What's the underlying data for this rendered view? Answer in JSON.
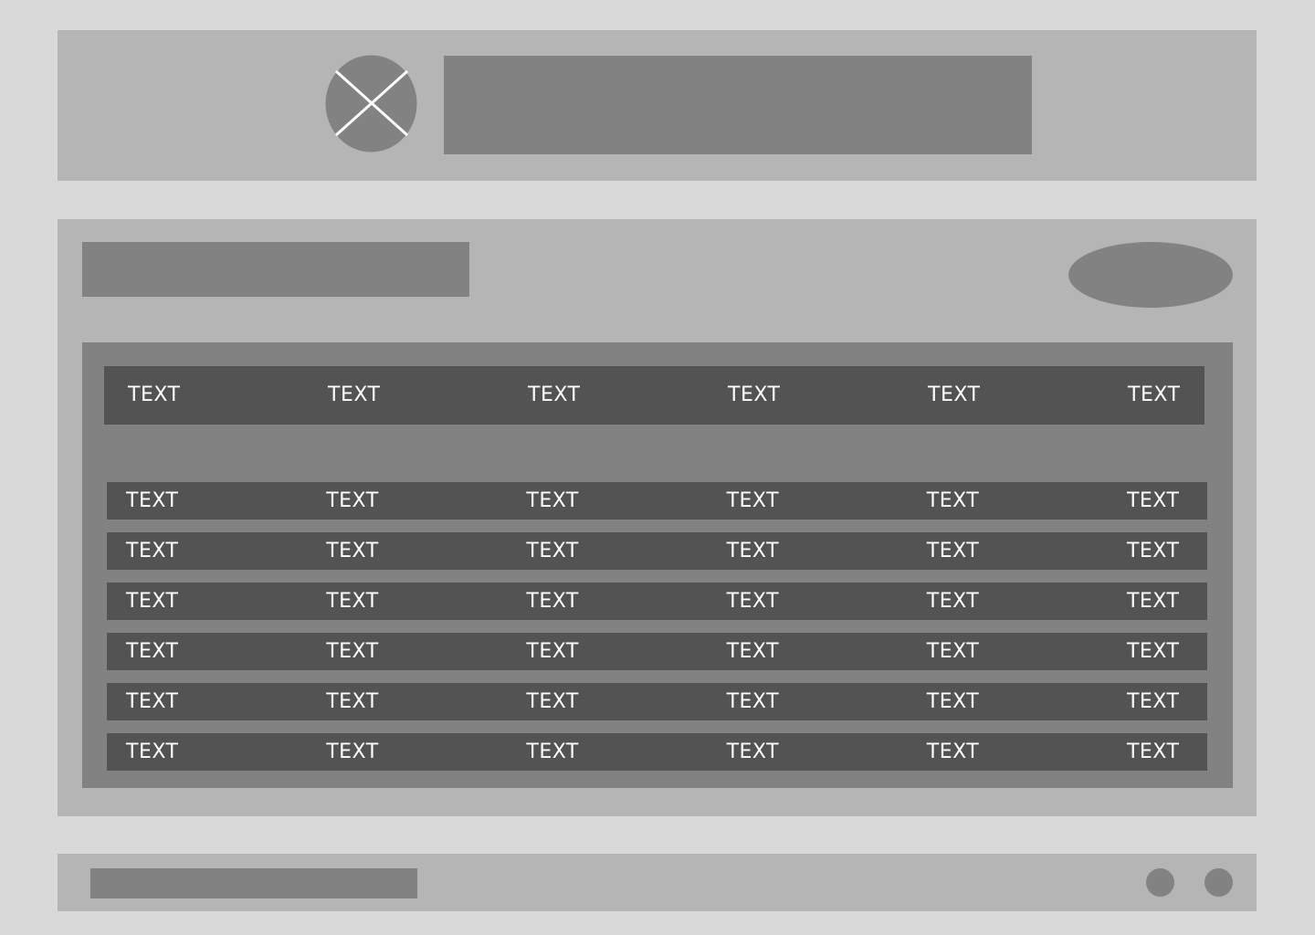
{
  "header": {
    "logo_icon": "image-placeholder-icon"
  },
  "table": {
    "headers": [
      "TEXT",
      "TEXT",
      "TEXT",
      "TEXT",
      "TEXT",
      "TEXT"
    ],
    "rows": [
      [
        "TEXT",
        "TEXT",
        "TEXT",
        "TEXT",
        "TEXT",
        "TEXT"
      ],
      [
        "TEXT",
        "TEXT",
        "TEXT",
        "TEXT",
        "TEXT",
        "TEXT"
      ],
      [
        "TEXT",
        "TEXT",
        "TEXT",
        "TEXT",
        "TEXT",
        "TEXT"
      ],
      [
        "TEXT",
        "TEXT",
        "TEXT",
        "TEXT",
        "TEXT",
        "TEXT"
      ],
      [
        "TEXT",
        "TEXT",
        "TEXT",
        "TEXT",
        "TEXT",
        "TEXT"
      ],
      [
        "TEXT",
        "TEXT",
        "TEXT",
        "TEXT",
        "TEXT",
        "TEXT"
      ]
    ]
  },
  "colors": {
    "page_background": "#d9d9d9",
    "panel": "#b6b5b5",
    "placeholder": "#828282",
    "row": "#535353",
    "row_text": "#ffffff"
  }
}
